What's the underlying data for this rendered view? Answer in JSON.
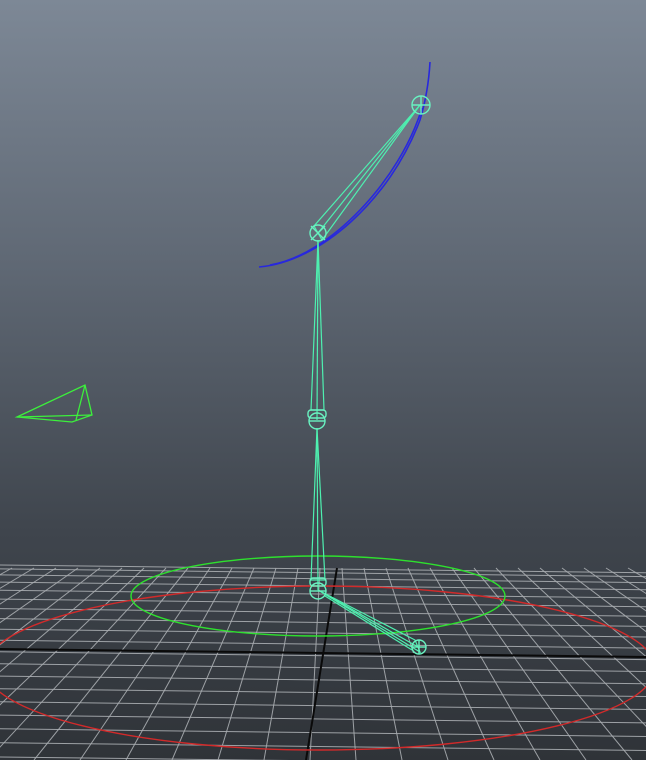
{
  "viewport": {
    "background_top": "#7d8896",
    "background_bottom": "#2f3338",
    "grid_color": "#a9adb1",
    "axis_color": "#0a0a0a"
  },
  "rig": {
    "bone_color": "#4ef0b0",
    "joint_color": "#69f2c1",
    "ik_curve_color": "#2828dd",
    "inner_control_color": "#2ee02e",
    "outer_control_color": "#d22a2a",
    "camera_icon_color": "#3cf03c"
  }
}
